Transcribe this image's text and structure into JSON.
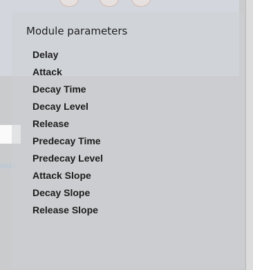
{
  "background": {
    "partial_label": "OUT"
  },
  "menu": {
    "title": "Module parameters",
    "items": [
      "Delay",
      "Attack",
      "Decay Time",
      "Decay Level",
      "Release",
      "Predecay Time",
      "Predecay Level",
      "Attack Slope",
      "Decay Slope",
      "Release Slope"
    ]
  },
  "colors": {
    "background": "#c9cbcc",
    "menu_text": "#1c1c1c",
    "top_panel": "#d3d7dd"
  }
}
